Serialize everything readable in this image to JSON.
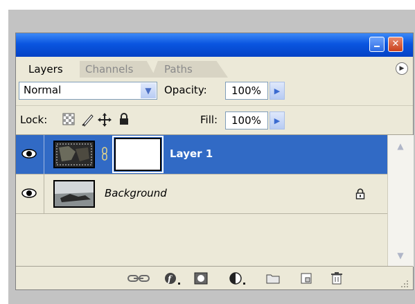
{
  "window": {
    "minimize_icon": "minimize-icon",
    "close_label": "✕"
  },
  "tabs": [
    {
      "label": "Layers",
      "active": true
    },
    {
      "label": "Channels",
      "active": false
    },
    {
      "label": "Paths",
      "active": false
    }
  ],
  "blend_mode": {
    "value": "Normal",
    "arrow": "▼"
  },
  "opacity": {
    "label": "Opacity:",
    "value": "100%"
  },
  "lock": {
    "label": "Lock:"
  },
  "fill": {
    "label": "Fill:",
    "value": "100%"
  },
  "layers": [
    {
      "name": "Layer 1",
      "selected": true,
      "visible": true
    },
    {
      "name": "Background",
      "selected": false,
      "visible": true,
      "locked": true
    }
  ],
  "bottom_icons": [
    "link-layers-icon",
    "layer-style-icon",
    "layer-mask-icon",
    "adjustment-layer-icon",
    "new-group-icon",
    "new-layer-icon",
    "delete-layer-icon"
  ],
  "colors": {
    "titlebar": "#0a55e0",
    "panel_bg": "#ece9d8",
    "selection": "#316ac5"
  }
}
